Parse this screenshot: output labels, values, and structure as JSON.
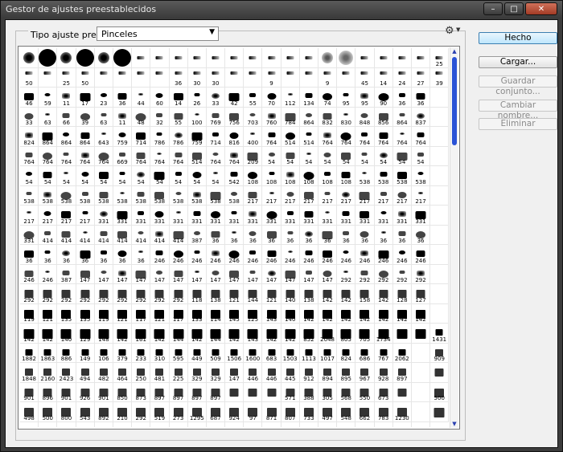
{
  "window": {
    "title": "Gestor de ajustes preestablecidos",
    "min": "–",
    "max": "□",
    "close": "✕"
  },
  "preset": {
    "label": "Tipo ajuste preest.:",
    "value": "Pinceles",
    "options": [
      "Pinceles"
    ]
  },
  "buttons": {
    "done": "Hecho",
    "load": "Cargar...",
    "save": "Guardar conjunto...",
    "rename": "Cambiar nombre...",
    "delete": "Eliminar"
  },
  "icons": {
    "gear": "gear-icon",
    "dropdown": "chevron-down-icon"
  },
  "colors": {
    "accent": "#2a52d6",
    "default_button": "#bee6fd"
  },
  "brushes": {
    "columns": 23,
    "rows": [
      [
        "",
        "",
        "",
        "",
        "",
        "",
        "",
        "",
        "",
        "",
        "",
        "",
        "",
        "",
        "",
        "",
        "",
        "",
        "",
        "",
        "",
        "",
        "25"
      ],
      [
        "50",
        "",
        "25",
        "50",
        "",
        "",
        "",
        "",
        "36",
        "30",
        "30",
        "",
        "",
        "9",
        "",
        "",
        "9",
        "",
        "45",
        "14",
        "24",
        "27",
        "39"
      ],
      [
        "46",
        "59",
        "11",
        "17",
        "23",
        "36",
        "44",
        "60",
        "14",
        "26",
        "33",
        "42",
        "55",
        "70",
        "112",
        "134",
        "74",
        "95",
        "95",
        "90",
        "36",
        "36",
        ""
      ],
      [
        "33",
        "63",
        "66",
        "39",
        "63",
        "11",
        "48",
        "32",
        "55",
        "100",
        "769",
        "756",
        "703",
        "760",
        "784",
        "864",
        "832",
        "830",
        "848",
        "856",
        "864",
        "837",
        ""
      ],
      [
        "824",
        "864",
        "864",
        "864",
        "643",
        "759",
        "714",
        "786",
        "786",
        "759",
        "714",
        "816",
        "400",
        "764",
        "514",
        "514",
        "764",
        "764",
        "764",
        "764",
        "764",
        "764",
        ""
      ],
      [
        "764",
        "764",
        "764",
        "764",
        "764",
        "669",
        "764",
        "764",
        "764",
        "514",
        "764",
        "764",
        "209",
        "54",
        "54",
        "54",
        "54",
        "54",
        "54",
        "54",
        "54",
        "54",
        ""
      ],
      [
        "54",
        "54",
        "54",
        "54",
        "54",
        "54",
        "54",
        "54",
        "54",
        "54",
        "54",
        "542",
        "108",
        "108",
        "108",
        "108",
        "108",
        "108",
        "538",
        "538",
        "538",
        "538",
        ""
      ],
      [
        "538",
        "538",
        "538",
        "538",
        "538",
        "538",
        "538",
        "538",
        "538",
        "538",
        "538",
        "538",
        "217",
        "217",
        "217",
        "217",
        "217",
        "217",
        "217",
        "217",
        "217",
        "217",
        ""
      ],
      [
        "217",
        "217",
        "217",
        "217",
        "331",
        "331",
        "331",
        "331",
        "331",
        "331",
        "331",
        "331",
        "331",
        "331",
        "331",
        "331",
        "331",
        "331",
        "331",
        "331",
        "331",
        "331",
        ""
      ],
      [
        "331",
        "414",
        "414",
        "414",
        "414",
        "414",
        "414",
        "414",
        "414",
        "387",
        "36",
        "36",
        "36",
        "36",
        "36",
        "36",
        "36",
        "36",
        "36",
        "36",
        "36",
        "36",
        ""
      ],
      [
        "36",
        "36",
        "36",
        "36",
        "36",
        "36",
        "36",
        "246",
        "246",
        "246",
        "246",
        "246",
        "246",
        "246",
        "246",
        "246",
        "246",
        "246",
        "246",
        "246",
        "246",
        "246",
        ""
      ],
      [
        "246",
        "246",
        "387",
        "147",
        "147",
        "147",
        "147",
        "147",
        "147",
        "147",
        "147",
        "147",
        "147",
        "147",
        "147",
        "147",
        "147",
        "292",
        "292",
        "292",
        "292",
        "292",
        ""
      ],
      [
        "292",
        "292",
        "292",
        "292",
        "292",
        "292",
        "292",
        "292",
        "292",
        "118",
        "138",
        "121",
        "144",
        "121",
        "140",
        "138",
        "142",
        "142",
        "158",
        "142",
        "128",
        "127",
        ""
      ],
      [
        "119",
        "121",
        "135",
        "135",
        "119",
        "121",
        "117",
        "121",
        "117",
        "133",
        "114",
        "145",
        "125",
        "143",
        "140",
        "142",
        "142",
        "142",
        "142",
        "142",
        "142",
        "142",
        ""
      ],
      [
        "142",
        "142",
        "140",
        "129",
        "148",
        "142",
        "161",
        "142",
        "144",
        "142",
        "144",
        "142",
        "143",
        "142",
        "142",
        "852",
        "2048",
        "805",
        "705",
        "1734",
        "",
        ""
      ],
      [
        "1431",
        "1882",
        "1863",
        "886",
        "149",
        "106",
        "379",
        "233",
        "310",
        "595",
        "449",
        "509",
        "1506",
        "1600",
        "683",
        "1503",
        "1113",
        "1017",
        "824",
        "686",
        "767",
        "2062",
        ""
      ],
      [
        "909",
        "1848",
        "2160",
        "2423",
        "494",
        "482",
        "464",
        "250",
        "481",
        "225",
        "329",
        "329",
        "147",
        "446",
        "446",
        "445",
        "912",
        "894",
        "895",
        "967",
        "928",
        "897",
        ""
      ],
      [
        "",
        "901",
        "896",
        "901",
        "926",
        "901",
        "850",
        "873",
        "897",
        "897",
        "897",
        "897",
        "",
        "",
        "",
        "571",
        "388",
        "305",
        "568",
        "550",
        "673",
        "",
        ""
      ],
      [
        "500",
        "498",
        "500",
        "800",
        "543",
        "892",
        "210",
        "292",
        "519",
        "273",
        "1295",
        "687",
        "924",
        "97",
        "871",
        "807",
        "733",
        "497",
        "548",
        "662",
        "783",
        "1230",
        ""
      ],
      [
        "",
        "",
        "",
        "",
        "",
        "",
        "",
        "",
        "",
        "",
        "",
        "",
        "",
        "",
        "",
        "",
        "",
        "",
        "",
        "",
        "",
        "",
        ""
      ]
    ]
  }
}
